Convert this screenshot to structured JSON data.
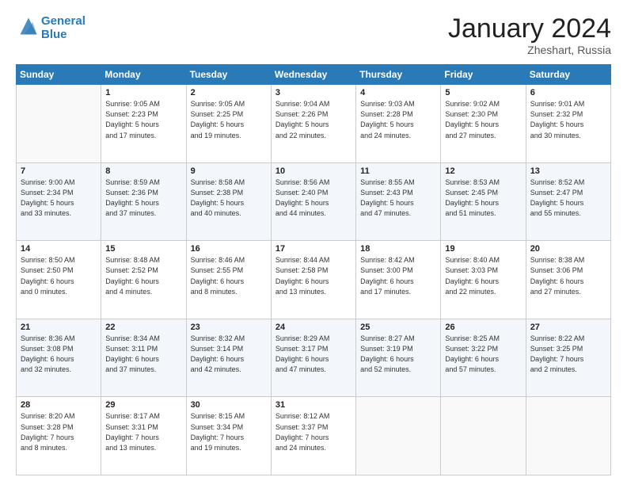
{
  "header": {
    "logo_line1": "General",
    "logo_line2": "Blue",
    "month": "January 2024",
    "location": "Zheshart, Russia"
  },
  "weekdays": [
    "Sunday",
    "Monday",
    "Tuesday",
    "Wednesday",
    "Thursday",
    "Friday",
    "Saturday"
  ],
  "weeks": [
    [
      {
        "day": "",
        "info": ""
      },
      {
        "day": "1",
        "info": "Sunrise: 9:05 AM\nSunset: 2:23 PM\nDaylight: 5 hours\nand 17 minutes."
      },
      {
        "day": "2",
        "info": "Sunrise: 9:05 AM\nSunset: 2:25 PM\nDaylight: 5 hours\nand 19 minutes."
      },
      {
        "day": "3",
        "info": "Sunrise: 9:04 AM\nSunset: 2:26 PM\nDaylight: 5 hours\nand 22 minutes."
      },
      {
        "day": "4",
        "info": "Sunrise: 9:03 AM\nSunset: 2:28 PM\nDaylight: 5 hours\nand 24 minutes."
      },
      {
        "day": "5",
        "info": "Sunrise: 9:02 AM\nSunset: 2:30 PM\nDaylight: 5 hours\nand 27 minutes."
      },
      {
        "day": "6",
        "info": "Sunrise: 9:01 AM\nSunset: 2:32 PM\nDaylight: 5 hours\nand 30 minutes."
      }
    ],
    [
      {
        "day": "7",
        "info": "Sunrise: 9:00 AM\nSunset: 2:34 PM\nDaylight: 5 hours\nand 33 minutes."
      },
      {
        "day": "8",
        "info": "Sunrise: 8:59 AM\nSunset: 2:36 PM\nDaylight: 5 hours\nand 37 minutes."
      },
      {
        "day": "9",
        "info": "Sunrise: 8:58 AM\nSunset: 2:38 PM\nDaylight: 5 hours\nand 40 minutes."
      },
      {
        "day": "10",
        "info": "Sunrise: 8:56 AM\nSunset: 2:40 PM\nDaylight: 5 hours\nand 44 minutes."
      },
      {
        "day": "11",
        "info": "Sunrise: 8:55 AM\nSunset: 2:43 PM\nDaylight: 5 hours\nand 47 minutes."
      },
      {
        "day": "12",
        "info": "Sunrise: 8:53 AM\nSunset: 2:45 PM\nDaylight: 5 hours\nand 51 minutes."
      },
      {
        "day": "13",
        "info": "Sunrise: 8:52 AM\nSunset: 2:47 PM\nDaylight: 5 hours\nand 55 minutes."
      }
    ],
    [
      {
        "day": "14",
        "info": "Sunrise: 8:50 AM\nSunset: 2:50 PM\nDaylight: 6 hours\nand 0 minutes."
      },
      {
        "day": "15",
        "info": "Sunrise: 8:48 AM\nSunset: 2:52 PM\nDaylight: 6 hours\nand 4 minutes."
      },
      {
        "day": "16",
        "info": "Sunrise: 8:46 AM\nSunset: 2:55 PM\nDaylight: 6 hours\nand 8 minutes."
      },
      {
        "day": "17",
        "info": "Sunrise: 8:44 AM\nSunset: 2:58 PM\nDaylight: 6 hours\nand 13 minutes."
      },
      {
        "day": "18",
        "info": "Sunrise: 8:42 AM\nSunset: 3:00 PM\nDaylight: 6 hours\nand 17 minutes."
      },
      {
        "day": "19",
        "info": "Sunrise: 8:40 AM\nSunset: 3:03 PM\nDaylight: 6 hours\nand 22 minutes."
      },
      {
        "day": "20",
        "info": "Sunrise: 8:38 AM\nSunset: 3:06 PM\nDaylight: 6 hours\nand 27 minutes."
      }
    ],
    [
      {
        "day": "21",
        "info": "Sunrise: 8:36 AM\nSunset: 3:08 PM\nDaylight: 6 hours\nand 32 minutes."
      },
      {
        "day": "22",
        "info": "Sunrise: 8:34 AM\nSunset: 3:11 PM\nDaylight: 6 hours\nand 37 minutes."
      },
      {
        "day": "23",
        "info": "Sunrise: 8:32 AM\nSunset: 3:14 PM\nDaylight: 6 hours\nand 42 minutes."
      },
      {
        "day": "24",
        "info": "Sunrise: 8:29 AM\nSunset: 3:17 PM\nDaylight: 6 hours\nand 47 minutes."
      },
      {
        "day": "25",
        "info": "Sunrise: 8:27 AM\nSunset: 3:19 PM\nDaylight: 6 hours\nand 52 minutes."
      },
      {
        "day": "26",
        "info": "Sunrise: 8:25 AM\nSunset: 3:22 PM\nDaylight: 6 hours\nand 57 minutes."
      },
      {
        "day": "27",
        "info": "Sunrise: 8:22 AM\nSunset: 3:25 PM\nDaylight: 7 hours\nand 2 minutes."
      }
    ],
    [
      {
        "day": "28",
        "info": "Sunrise: 8:20 AM\nSunset: 3:28 PM\nDaylight: 7 hours\nand 8 minutes."
      },
      {
        "day": "29",
        "info": "Sunrise: 8:17 AM\nSunset: 3:31 PM\nDaylight: 7 hours\nand 13 minutes."
      },
      {
        "day": "30",
        "info": "Sunrise: 8:15 AM\nSunset: 3:34 PM\nDaylight: 7 hours\nand 19 minutes."
      },
      {
        "day": "31",
        "info": "Sunrise: 8:12 AM\nSunset: 3:37 PM\nDaylight: 7 hours\nand 24 minutes."
      },
      {
        "day": "",
        "info": ""
      },
      {
        "day": "",
        "info": ""
      },
      {
        "day": "",
        "info": ""
      }
    ]
  ]
}
